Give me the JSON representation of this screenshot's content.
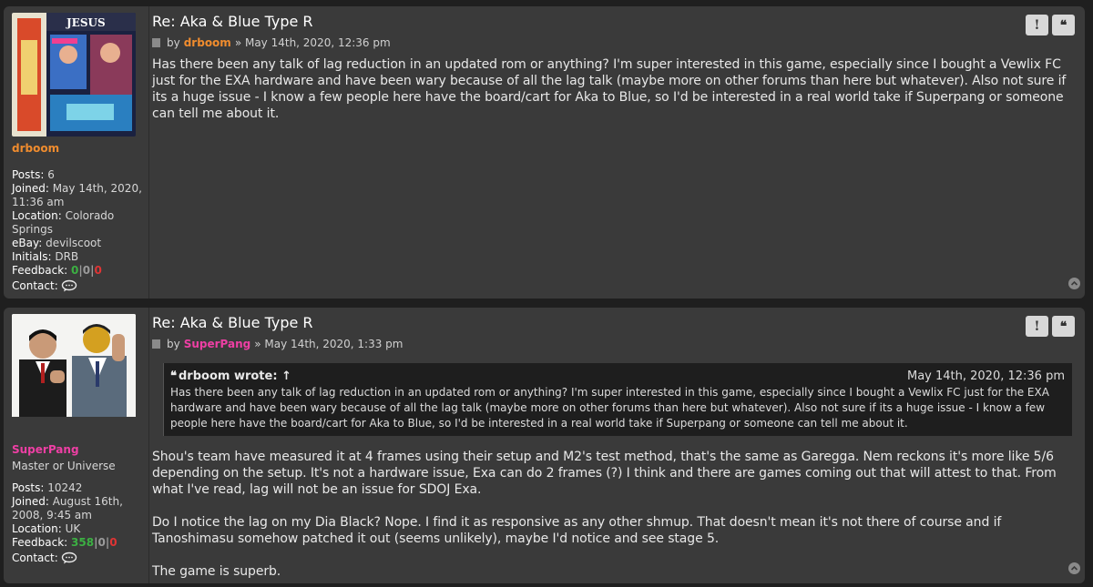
{
  "colors": {
    "drboom": "#f08c2e",
    "superpang": "#ee3fa4",
    "feedback_positive": "#3cb043",
    "feedback_neutral": "#9a9a9a",
    "feedback_negative": "#e03434"
  },
  "posts": [
    {
      "title": "Re: Aka & Blue Type R",
      "by": "by",
      "author": "drboom",
      "date": "» May 14th, 2020, 12:36 pm",
      "username": "drboom",
      "rank": "",
      "details": {
        "posts_label": "Posts:",
        "posts": "6",
        "joined_label": "Joined:",
        "joined": "May 14th, 2020, 11:36 am",
        "location_label": "Location:",
        "location": "Colorado Springs",
        "ebay_label": "eBay:",
        "ebay": "devilscoot",
        "initials_label": "Initials:",
        "initials": "DRB",
        "feedback_label": "Feedback:",
        "fb_pos": "0",
        "fb_neu": "0",
        "fb_neg": "0",
        "sep": "|",
        "contact_label": "Contact:"
      },
      "content": [
        "Has there been any talk of lag reduction in an updated rom or anything? I'm super interested in this game, especially since I bought a Vewlix FC just for the EXA hardware and have been wary because of all the lag talk (maybe more on other forums than here but whatever). Also not sure if its a huge issue - I know a few people here have the board/cart for Aka to Blue, so I'd be interested in a real world take if Superpang or someone can tell me about it."
      ],
      "actions": {
        "report": "!",
        "quote": "❝"
      }
    },
    {
      "title": "Re: Aka & Blue Type R",
      "by": "by",
      "author": "SuperPang",
      "date": "» May 14th, 2020, 1:33 pm",
      "username": "SuperPang",
      "rank": "Master or Universe",
      "details": {
        "posts_label": "Posts:",
        "posts": "10242",
        "joined_label": "Joined:",
        "joined": "August 16th, 2008, 9:45 am",
        "location_label": "Location:",
        "location": "UK",
        "feedback_label": "Feedback:",
        "fb_pos": "358",
        "fb_neu": "0",
        "fb_neg": "0",
        "sep": "|",
        "contact_label": "Contact:"
      },
      "quote": {
        "mark": "❝",
        "who": "drboom wrote: ↑",
        "date": "May 14th, 2020, 12:36 pm",
        "text": "Has there been any talk of lag reduction in an updated rom or anything? I'm super interested in this game, especially since I bought a Vewlix FC just for the EXA hardware and have been wary because of all the lag talk (maybe more on other forums than here but whatever). Also not sure if its a huge issue - I know a few people here have the board/cart for Aka to Blue, so I'd be interested in a real world take if Superpang or someone can tell me about it."
      },
      "content": [
        "Shou's team have measured it at 4 frames using their setup and M2's test method, that's the same as Garegga. Nem reckons it's more like 5/6 depending on the setup. It's not a hardware issue, Exa can do 2 frames (?) I think and there are games coming out that will attest to that. From what I've read, lag will not be an issue for SDOJ Exa.",
        "Do I notice the lag on my Dia Black? Nope. I find it as responsive as any other shmup. That doesn't mean it's not there of course and if Tanoshimasu somehow patched it out (seems unlikely), maybe I'd notice and see stage 5.",
        "The game is superb."
      ],
      "actions": {
        "report": "!",
        "quote": "❝"
      }
    }
  ],
  "avatar_text": {
    "jesus": "JESUS"
  }
}
